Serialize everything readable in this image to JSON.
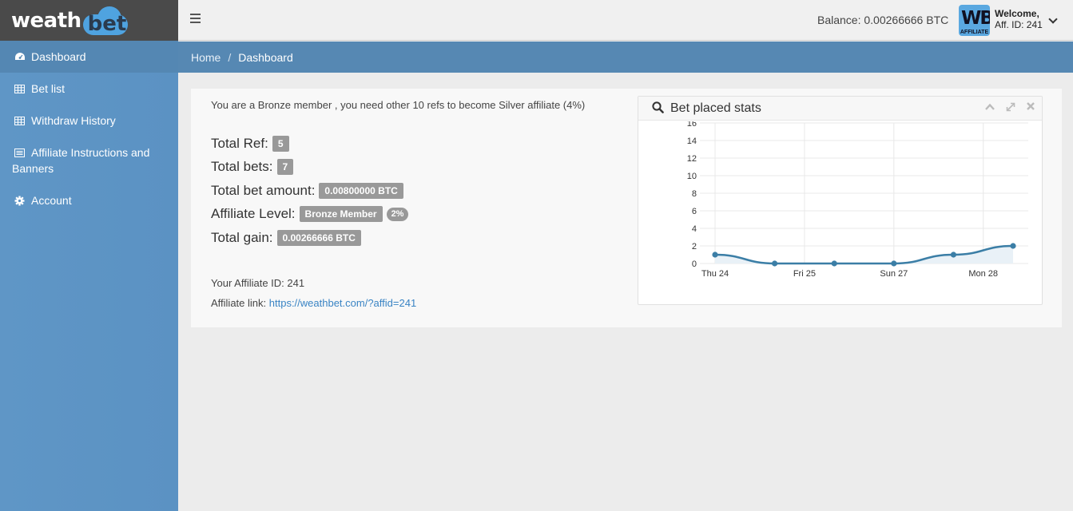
{
  "brand": {
    "logo_left": "weath",
    "logo_right": "bet"
  },
  "sidebar": {
    "items": [
      {
        "label": "Dashboard",
        "icon": "dashboard-icon"
      },
      {
        "label": "Bet list",
        "icon": "table-icon"
      },
      {
        "label": "Withdraw History",
        "icon": "table-icon"
      },
      {
        "label": "Affiliate Instructions and Banners",
        "icon": "list-icon"
      },
      {
        "label": "Account",
        "icon": "gear-icon"
      }
    ]
  },
  "topbar": {
    "balance": "Balance: 0.00266666 BTC",
    "avatar_text": "WB",
    "avatar_sub": "AFFILIATE",
    "welcome": "Welcome,",
    "aff_id": "Aff. ID: 241"
  },
  "breadcrumb": {
    "home": "Home",
    "separator": "/",
    "current": "Dashboard"
  },
  "main": {
    "notice": "You are a Bronze member , you need other 10 refs to become Silver affiliate (4%)",
    "stats": {
      "total_ref_label": "Total Ref:",
      "total_ref": "5",
      "total_bets_label": "Total bets:",
      "total_bets": "7",
      "total_bet_amount_label": "Total bet amount:",
      "total_bet_amount": "0.00800000 BTC",
      "affiliate_level_label": "Affiliate Level:",
      "affiliate_level": "Bronze Member",
      "affiliate_pct": "2%",
      "total_gain_label": "Total gain:",
      "total_gain": "0.00266666 BTC"
    },
    "affiliate_id": "Your Affiliate ID: 241",
    "affiliate_link_label": "Affiliate link:",
    "affiliate_link": "https://weathbet.com/?affid=241"
  },
  "widget": {
    "title": "Bet placed stats"
  },
  "chart_data": {
    "type": "area",
    "xlabel": "",
    "ylabel": "",
    "ylim": [
      0,
      16
    ],
    "yticks": [
      "0",
      "2",
      "4",
      "6",
      "8",
      "10",
      "12",
      "14",
      "16"
    ],
    "x_tick_labels": [
      "Thu 24",
      "Fri 25",
      "Sun 27",
      "Mon 28"
    ],
    "x_tick_index": [
      0,
      1.5,
      3,
      4.5
    ],
    "x": [
      0,
      1,
      2,
      3,
      4,
      5
    ],
    "values": [
      1,
      0,
      0,
      0,
      1,
      2
    ],
    "colors": {
      "line": "#3b7ea6",
      "fill": "#e9f1f7",
      "grid": "#e8e8e8"
    }
  }
}
